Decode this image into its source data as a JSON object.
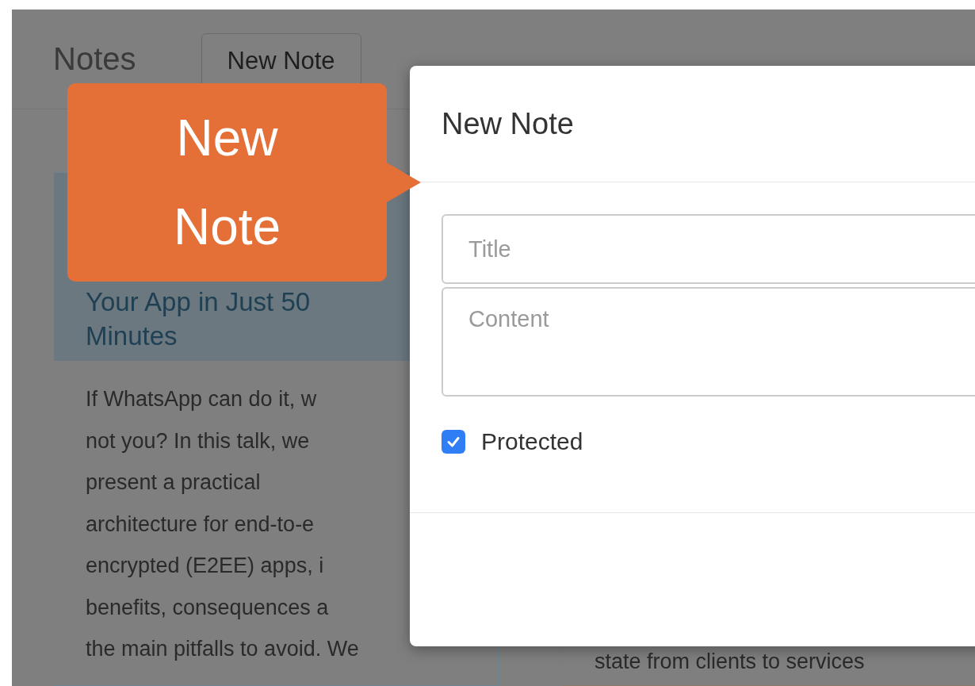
{
  "navbar": {
    "brand": "Notes",
    "new_button": "New Note"
  },
  "cards": [
    {
      "title_lines": [
        "Your App in Just 50",
        "Minutes"
      ],
      "body_lines": [
        "If WhatsApp can do it, w",
        "not you? In this talk, we",
        "present a practical",
        "architecture for end-to-e",
        "encrypted (E2EE) apps, i",
        "benefits, consequences a",
        "the main pitfalls to avoid. We"
      ]
    },
    {
      "body_lines": [
        "state from clients to services"
      ]
    }
  ],
  "modal": {
    "title": "New Note",
    "title_field": {
      "placeholder": "Title"
    },
    "content_field": {
      "placeholder": "Content"
    },
    "protected": {
      "label": "Protected",
      "checked": true
    }
  },
  "callout": {
    "text": "New Note"
  }
}
